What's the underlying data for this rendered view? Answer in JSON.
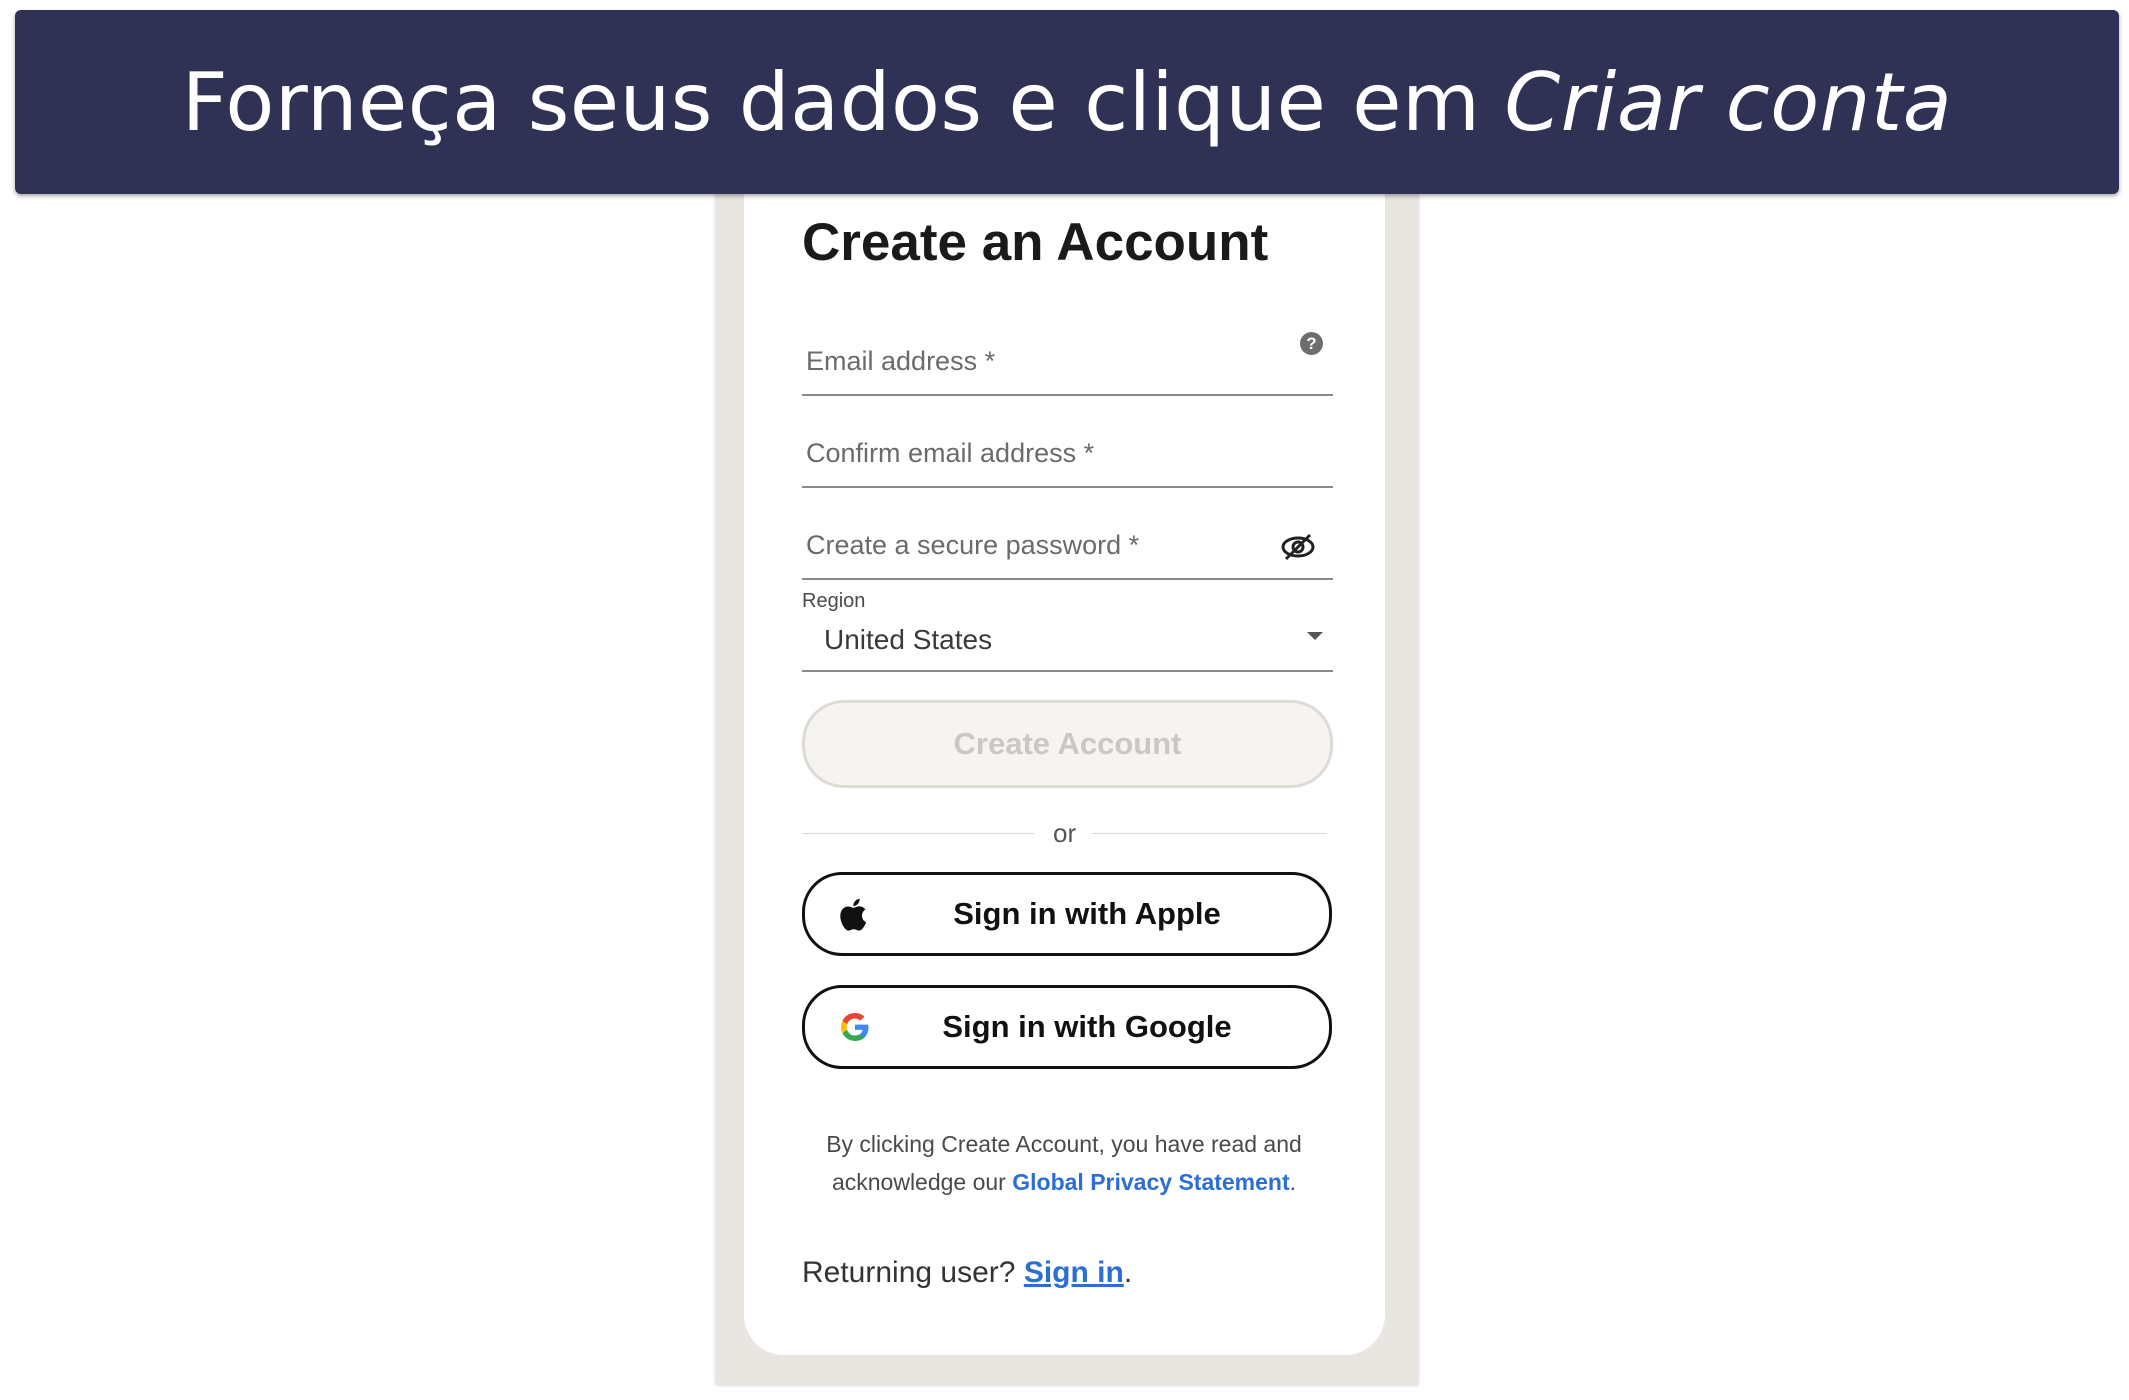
{
  "banner": {
    "text": "Forneça seus dados e clique em",
    "emphasis": "Criar conta",
    "background": "#2f3155"
  },
  "form": {
    "title": "Create an Account",
    "email_placeholder": "Email address *",
    "confirm_email_placeholder": "Confirm email address *",
    "password_placeholder": "Create a secure password *",
    "region_label": "Region",
    "region_value": "United States",
    "create_button": "Create Account",
    "or_text": "or",
    "apple_button": "Sign in with Apple",
    "google_button": "Sign in with Google",
    "legal_text": "By clicking Create Account, you have read and acknowledge our",
    "privacy_link": "Global Privacy Statement",
    "legal_end": ".",
    "returning_text": "Returning user?",
    "signin_link": "Sign in",
    "returning_end": "."
  },
  "icons": {
    "help": "help-icon",
    "password_toggle": "eye-slash-icon",
    "dropdown": "chevron-down-icon",
    "apple": "apple-icon",
    "google": "google-icon"
  },
  "colors": {
    "link": "#2b6fd6",
    "frame": "#e9e6e2"
  }
}
